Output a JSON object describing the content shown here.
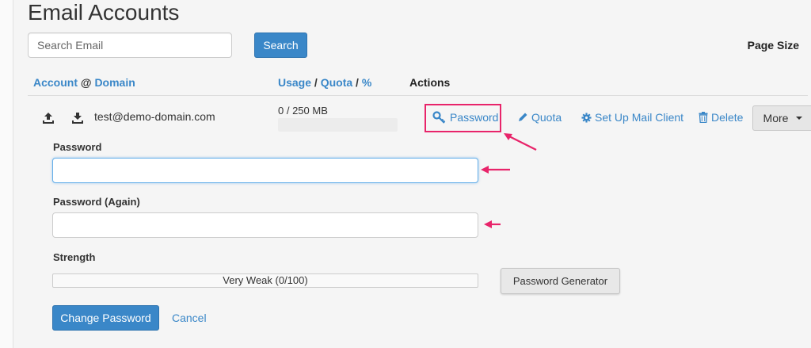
{
  "page": {
    "title": "Email Accounts"
  },
  "search": {
    "placeholder": "Search Email",
    "button_label": "Search"
  },
  "page_size_label": "Page Size",
  "table_header": {
    "account": "Account",
    "at": "@",
    "domain": "Domain",
    "usage": "Usage",
    "quota": "Quota",
    "percent": "%",
    "slash": "/",
    "actions": "Actions"
  },
  "account_row": {
    "email": "test@demo-domain.com",
    "usage_text": "0 / 250 MB",
    "usage_fraction": 0,
    "icons": [
      "upload-icon",
      "download-icon"
    ],
    "actions": {
      "password": "Password",
      "quota": "Quota",
      "mail_client": "Set Up Mail Client",
      "delete": "Delete",
      "more": "More"
    }
  },
  "password_form": {
    "password_label": "Password",
    "password_value": "",
    "password_again_label": "Password (Again)",
    "password_again_value": "",
    "strength_label": "Strength",
    "strength_text": "Very Weak (0/100)",
    "strength_value": 0,
    "generator_button": "Password Generator",
    "change_button": "Change Password",
    "cancel_link": "Cancel"
  },
  "colors": {
    "link": "#3a87c8",
    "primary_button": "#3a87c8",
    "annotation": "#e8246a",
    "focus_border": "#66afe9"
  }
}
